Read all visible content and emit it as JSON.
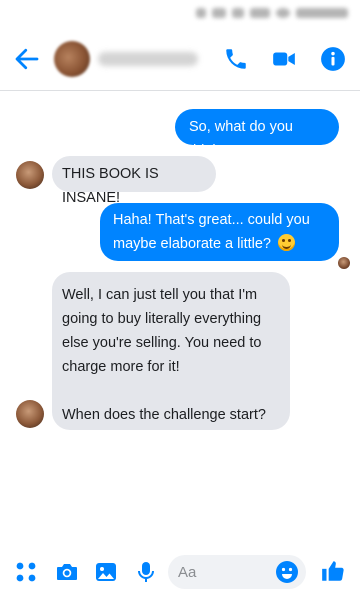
{
  "header": {
    "back_icon": "arrow-left-icon",
    "contact_name": "",
    "actions": [
      "phone-icon",
      "video-camera-icon",
      "info-icon"
    ]
  },
  "messages": [
    {
      "direction": "outgoing",
      "text": "So, what do you think?"
    },
    {
      "direction": "incoming",
      "text": "THIS BOOK IS INSANE!"
    },
    {
      "direction": "outgoing",
      "text_line1": "Haha! That's great... could you",
      "text_line2": "maybe elaborate a little?",
      "emoji": "laughing-emoji"
    },
    {
      "direction": "incoming",
      "lines": [
        "Well, I can just tell you that I'm",
        "going to buy literally everything",
        "else you're selling. You need to",
        "charge more for it!",
        "",
        "When does the challenge start?"
      ]
    }
  ],
  "composer": {
    "placeholder": "Aa",
    "icons": [
      "apps-icon",
      "camera-icon",
      "photo-icon",
      "microphone-icon",
      "emoji-icon",
      "like-icon"
    ]
  },
  "colors": {
    "accent": "#0084ff",
    "outgoing_bubble": "#0084ff",
    "incoming_bubble": "#e4e6eb"
  }
}
